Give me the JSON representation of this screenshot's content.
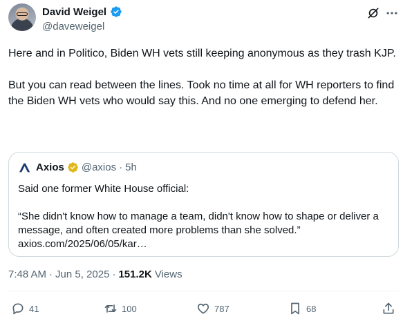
{
  "author": {
    "display_name": "David Weigel",
    "handle": "@daveweigel",
    "verified_color": "#1d9bf0"
  },
  "tweet": {
    "paragraphs": [
      "Here and in Politico, Biden WH vets still keeping anonymous as they trash KJP.",
      "But you can read between the lines. Took no time at all for WH reporters to find the Biden WH vets who would say this. And no one emerging to defend her."
    ]
  },
  "quote": {
    "name": "Axios",
    "handle": "@axios",
    "separator": "·",
    "time": "5h",
    "badge_color": "#e2b719",
    "brand_color": "#1c3b72",
    "paragraphs": [
      "Said one former White House official:",
      "“She didn't know how to manage a team, didn't know how to shape or deliver a message, and often created more problems than she solved.”"
    ],
    "link": "axios.com/2025/06/05/kar…"
  },
  "meta": {
    "time": "7:48 AM",
    "separator1": "·",
    "date": "Jun 5, 2025",
    "separator2": "·",
    "views_count": "151.2K",
    "views_label": "Views"
  },
  "actions": {
    "replies": "41",
    "reposts": "100",
    "likes": "787",
    "bookmarks": "68"
  },
  "icons": {
    "grok": "grok-icon",
    "more": "more-icon",
    "reply": "reply-icon",
    "repost": "repost-icon",
    "like": "heart-icon",
    "bookmark": "bookmark-icon"
  }
}
